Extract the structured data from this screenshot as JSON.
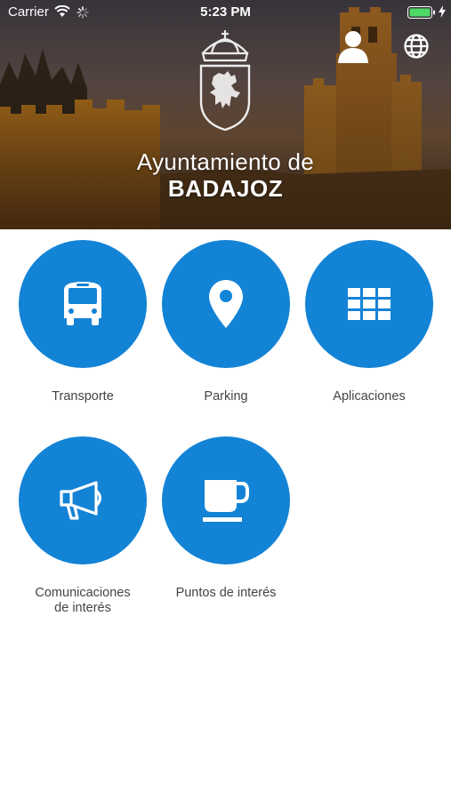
{
  "status_bar": {
    "carrier": "Carrier",
    "time": "5:23 PM",
    "battery_color": "#4cd964"
  },
  "header": {
    "title_line1": "Ayuntamiento de",
    "title_line2": "BADAJOZ",
    "icons": [
      "crest-icon",
      "user-icon",
      "globe-icon"
    ]
  },
  "tiles": [
    {
      "label": "Transporte",
      "icon": "bus-icon"
    },
    {
      "label": "Parking",
      "icon": "map-pin-icon"
    },
    {
      "label": "Aplicaciones",
      "icon": "grid-icon"
    },
    {
      "label_lines": [
        "Comunicaciones",
        "de interés"
      ],
      "icon": "megaphone-icon"
    },
    {
      "label": "Puntos de interés",
      "icon": "coffee-cup-icon"
    }
  ],
  "colors": {
    "accent": "#1383d6",
    "label_text": "#444444"
  }
}
